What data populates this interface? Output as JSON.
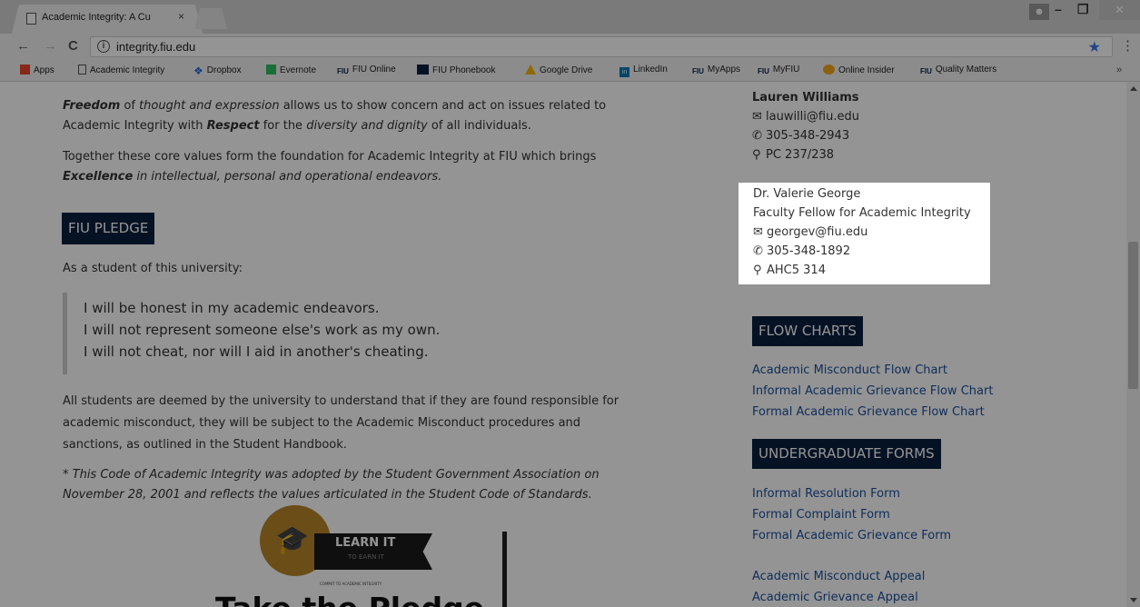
{
  "browser": {
    "tab_title": "Academic Integrity: A Cu",
    "tab_close": "×",
    "url": "integrity.fiu.edu",
    "bookmarks": [
      {
        "label": "Apps",
        "icon": "apps-grid-icon"
      },
      {
        "label": "Academic Integrity",
        "icon": "page-icon"
      },
      {
        "label": "Dropbox",
        "icon": "dropbox-icon"
      },
      {
        "label": "Evernote",
        "icon": "evernote-icon"
      },
      {
        "label": "FIU Online",
        "icon": "fiu-icon"
      },
      {
        "label": "FIU Phonebook",
        "icon": "fiu-phonebook-icon"
      },
      {
        "label": "Google Drive",
        "icon": "google-drive-icon"
      },
      {
        "label": "LinkedIn",
        "icon": "linkedin-icon"
      },
      {
        "label": "MyApps",
        "icon": "fiu-icon"
      },
      {
        "label": "MyFIU",
        "icon": "fiu-icon"
      },
      {
        "label": "Online Insider",
        "icon": "online-insider-icon"
      },
      {
        "label": "Quality Matters",
        "icon": "fiu-icon"
      }
    ]
  },
  "content": {
    "p1_b1": "Freedom",
    "p1_t1": " of ",
    "p1_i1": "thought and expression",
    "p1_t2": " allows us to show concern and act on issues related to Academic Integrity with ",
    "p1_b2": "Respect",
    "p1_t3": " for the ",
    "p1_i2": "diversity and dignity",
    "p1_t4": " of all individuals.",
    "p2_t1": "Together these core values form the foundation for Academic Integrity at FIU which brings ",
    "p2_b1": "Excellence",
    "p2_i1": " in intellectual, personal and operational endeavors.",
    "pledge_heading": "FIU PLEDGE",
    "pledge_intro": "As a student of this university:",
    "pledge_lines": [
      "I will be honest in my academic endeavors.",
      "I will not represent someone else's work as my own.",
      "I will not cheat, nor will I aid in another's cheating."
    ],
    "p4": "All students are deemed by the university to understand that if they are found responsible for academic misconduct, they will be subject to the Academic Misconduct procedures and sanctions, as outlined in the Student Handbook.",
    "p5": "* This Code of Academic Integrity was adopted by the Student Government Association on November 28, 2001 and reflects the values articulated in the Student Code of Standards.",
    "badge_line1": "LEARN IT",
    "badge_line2": "TO EARN IT",
    "badge_line3": "COMMIT TO ACADEMIC INTEGRITY",
    "take_pledge": "Take the Pledge"
  },
  "sidebar": {
    "contact1": {
      "name": "Lauren Williams",
      "email": "lauwilli@fiu.edu",
      "phone": "305-348-2943",
      "office": "PC 237/238"
    },
    "contact2": {
      "name": "Dr. Valerie George",
      "title": "Faculty Fellow for Academic Integrity",
      "email": "georgev@fiu.edu",
      "phone": "305-348-1892",
      "office": "AHC5 314"
    },
    "flow_heading": "FLOW CHARTS",
    "flow_links": [
      "Academic Misconduct Flow Chart",
      "Informal Academic Grievance Flow Chart",
      "Formal Academic Grievance Flow Chart"
    ],
    "forms_heading": "UNDERGRADUATE FORMS",
    "form_links": [
      "Informal Resolution Form",
      "Formal Complaint Form",
      "Formal Academic Grievance Form"
    ],
    "appeal_links": [
      "Academic Misconduct Appeal",
      "Academic Grievance Appeal"
    ]
  },
  "colors": {
    "heading_bg": "#0a1f3f",
    "link": "#1a4f9c",
    "badge_gold": "#b8862a",
    "star": "#3b78e7"
  }
}
